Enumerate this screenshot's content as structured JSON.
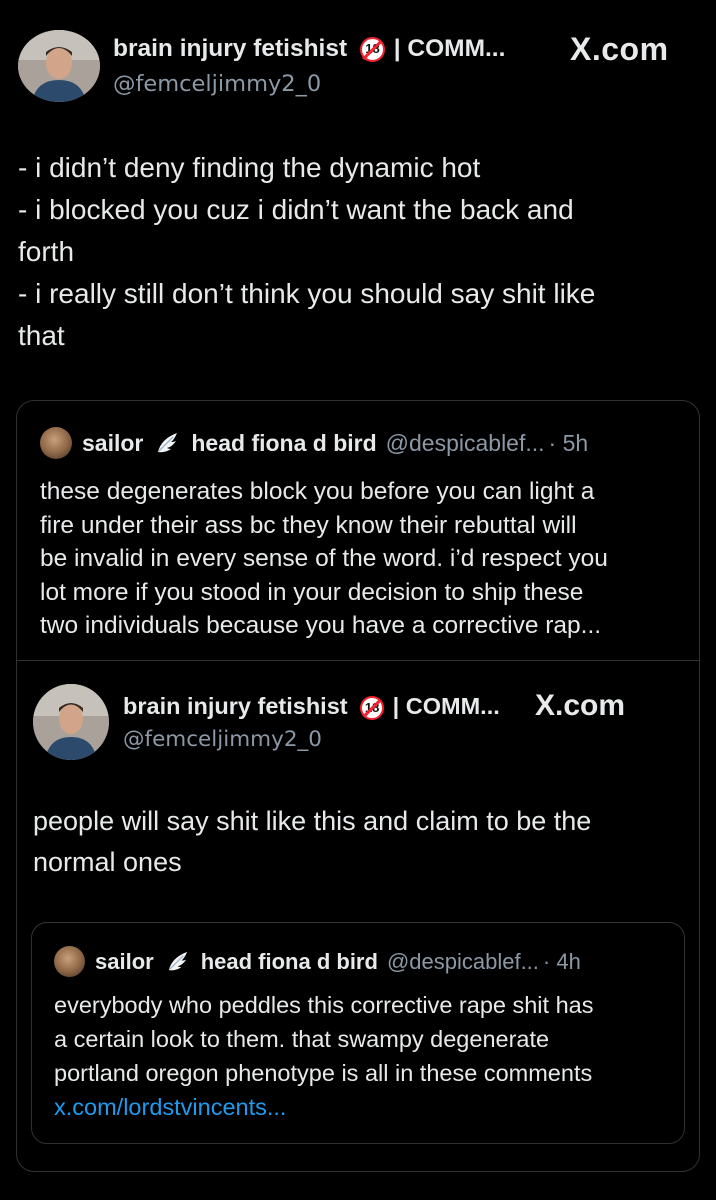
{
  "tweet_main": {
    "author_name": "brain injury fetishist",
    "author_suffix": " | COMM...",
    "age_badge": "18",
    "handle": "@femceljimmy2_0",
    "brand": "X.com",
    "body_lines": [
      "- i didn’t deny finding the dynamic hot",
      "- i blocked you cuz i didn’t want the back and",
      "forth",
      "- i really still don’t think you should say shit like",
      "that"
    ]
  },
  "quote_1": {
    "name": "sailor",
    "name_2": "head fiona d bird",
    "handle": "@despicablef...",
    "time": "· 5h",
    "body_lines": [
      "these degenerates block you before you can light a",
      "fire under their ass bc they know their rebuttal will",
      "be invalid in every sense of the word. i’d respect you",
      "lot more if you stood in your decision to ship these",
      "two individuals because you have a corrective rap..."
    ]
  },
  "tweet_inner": {
    "author_name": "brain injury fetishist",
    "author_suffix": " | COMM...",
    "age_badge": "18",
    "handle": "@femceljimmy2_0",
    "brand": "X.com",
    "body_lines": [
      "people will say shit like this and claim to be the",
      "normal ones"
    ]
  },
  "quote_2": {
    "name": "sailor",
    "name_2": "head fiona d bird",
    "handle": "@despicablef...",
    "time": "· 4h",
    "body_lines": [
      "everybody who peddles this corrective rape shit has",
      "a certain look to them. that swampy degenerate",
      "portland oregon phenotype is all in these comments"
    ],
    "link": "x.com/lordstvincents..."
  },
  "colors": {
    "background": "#000000",
    "text": "#e7e9ea",
    "secondary": "#8b98a5",
    "border": "#2f3336",
    "link": "#1d9bf0",
    "badge_red": "#f4212e"
  },
  "icons": {
    "age": "adults-only-18-icon",
    "feather": "angel-wing-icon"
  }
}
